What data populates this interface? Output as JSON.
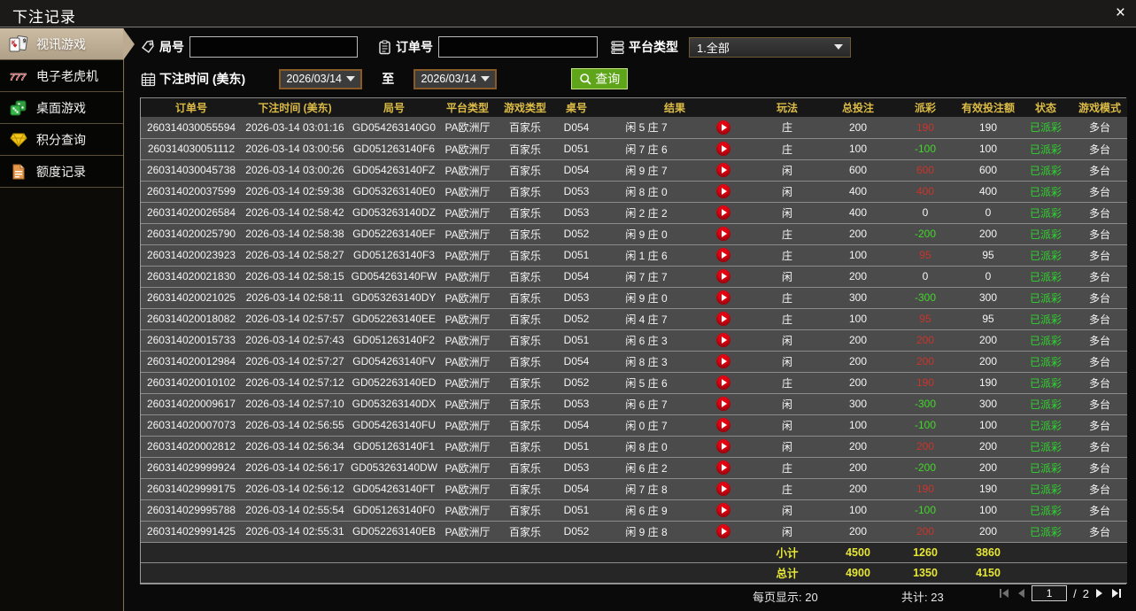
{
  "window": {
    "title": "下注记录",
    "close": "×"
  },
  "sidebar": {
    "items": [
      {
        "label": "视讯游戏",
        "icon": "playing-cards-icon",
        "active": true
      },
      {
        "label": "电子老虎机",
        "icon": "slot-777-icon",
        "active": false
      },
      {
        "label": "桌面游戏",
        "icon": "table-games-icon",
        "active": false
      },
      {
        "label": "积分查询",
        "icon": "gem-icon",
        "active": false
      },
      {
        "label": "额度记录",
        "icon": "document-icon",
        "active": false
      }
    ]
  },
  "filters": {
    "round_label": "局号",
    "round_value": "",
    "order_label": "订单号",
    "order_value": "",
    "platform_label": "平台类型",
    "platform_value": "1.全部",
    "bet_time_label": "下注时间 (美东)",
    "date_from": "2026/03/14",
    "to_label": "至",
    "date_to": "2026/03/14",
    "query_label": "查询"
  },
  "table": {
    "columns": [
      "订单号",
      "下注时间 (美东)",
      "局号",
      "平台类型",
      "游戏类型",
      "桌号",
      "结果",
      "玩法",
      "总投注",
      "派彩",
      "有效投注额",
      "状态",
      "游戏模式"
    ],
    "rows": [
      {
        "order": "260314030055594",
        "time": "2026-03-14 03:01:16",
        "round": "GD054263140G0",
        "platform": "PA欧洲厅",
        "game": "百家乐",
        "table": "D054",
        "result": "闲 5 庄 7",
        "play": "庄",
        "bet": "200",
        "payout": "190",
        "valid": "190",
        "status": "已派彩",
        "mode": "多台"
      },
      {
        "order": "260314030051112",
        "time": "2026-03-14 03:00:56",
        "round": "GD051263140F6",
        "platform": "PA欧洲厅",
        "game": "百家乐",
        "table": "D051",
        "result": "闲 7 庄 6",
        "play": "庄",
        "bet": "100",
        "payout": "-100",
        "valid": "100",
        "status": "已派彩",
        "mode": "多台"
      },
      {
        "order": "260314030045738",
        "time": "2026-03-14 03:00:26",
        "round": "GD054263140FZ",
        "platform": "PA欧洲厅",
        "game": "百家乐",
        "table": "D054",
        "result": "闲 9 庄 7",
        "play": "闲",
        "bet": "600",
        "payout": "600",
        "valid": "600",
        "status": "已派彩",
        "mode": "多台"
      },
      {
        "order": "260314020037599",
        "time": "2026-03-14 02:59:38",
        "round": "GD053263140E0",
        "platform": "PA欧洲厅",
        "game": "百家乐",
        "table": "D053",
        "result": "闲 8 庄 0",
        "play": "闲",
        "bet": "400",
        "payout": "400",
        "valid": "400",
        "status": "已派彩",
        "mode": "多台"
      },
      {
        "order": "260314020026584",
        "time": "2026-03-14 02:58:42",
        "round": "GD053263140DZ",
        "platform": "PA欧洲厅",
        "game": "百家乐",
        "table": "D053",
        "result": "闲 2 庄 2",
        "play": "闲",
        "bet": "400",
        "payout": "0",
        "valid": "0",
        "status": "已派彩",
        "mode": "多台"
      },
      {
        "order": "260314020025790",
        "time": "2026-03-14 02:58:38",
        "round": "GD052263140EF",
        "platform": "PA欧洲厅",
        "game": "百家乐",
        "table": "D052",
        "result": "闲 9 庄 0",
        "play": "庄",
        "bet": "200",
        "payout": "-200",
        "valid": "200",
        "status": "已派彩",
        "mode": "多台"
      },
      {
        "order": "260314020023923",
        "time": "2026-03-14 02:58:27",
        "round": "GD051263140F3",
        "platform": "PA欧洲厅",
        "game": "百家乐",
        "table": "D051",
        "result": "闲 1 庄 6",
        "play": "庄",
        "bet": "100",
        "payout": "95",
        "valid": "95",
        "status": "已派彩",
        "mode": "多台"
      },
      {
        "order": "260314020021830",
        "time": "2026-03-14 02:58:15",
        "round": "GD054263140FW",
        "platform": "PA欧洲厅",
        "game": "百家乐",
        "table": "D054",
        "result": "闲 7 庄 7",
        "play": "闲",
        "bet": "200",
        "payout": "0",
        "valid": "0",
        "status": "已派彩",
        "mode": "多台"
      },
      {
        "order": "260314020021025",
        "time": "2026-03-14 02:58:11",
        "round": "GD053263140DY",
        "platform": "PA欧洲厅",
        "game": "百家乐",
        "table": "D053",
        "result": "闲 9 庄 0",
        "play": "庄",
        "bet": "300",
        "payout": "-300",
        "valid": "300",
        "status": "已派彩",
        "mode": "多台"
      },
      {
        "order": "260314020018082",
        "time": "2026-03-14 02:57:57",
        "round": "GD052263140EE",
        "platform": "PA欧洲厅",
        "game": "百家乐",
        "table": "D052",
        "result": "闲 4 庄 7",
        "play": "庄",
        "bet": "100",
        "payout": "95",
        "valid": "95",
        "status": "已派彩",
        "mode": "多台"
      },
      {
        "order": "260314020015733",
        "time": "2026-03-14 02:57:43",
        "round": "GD051263140F2",
        "platform": "PA欧洲厅",
        "game": "百家乐",
        "table": "D051",
        "result": "闲 6 庄 3",
        "play": "闲",
        "bet": "200",
        "payout": "200",
        "valid": "200",
        "status": "已派彩",
        "mode": "多台"
      },
      {
        "order": "260314020012984",
        "time": "2026-03-14 02:57:27",
        "round": "GD054263140FV",
        "platform": "PA欧洲厅",
        "game": "百家乐",
        "table": "D054",
        "result": "闲 8 庄 3",
        "play": "闲",
        "bet": "200",
        "payout": "200",
        "valid": "200",
        "status": "已派彩",
        "mode": "多台"
      },
      {
        "order": "260314020010102",
        "time": "2026-03-14 02:57:12",
        "round": "GD052263140ED",
        "platform": "PA欧洲厅",
        "game": "百家乐",
        "table": "D052",
        "result": "闲 5 庄 6",
        "play": "庄",
        "bet": "200",
        "payout": "190",
        "valid": "190",
        "status": "已派彩",
        "mode": "多台"
      },
      {
        "order": "260314020009617",
        "time": "2026-03-14 02:57:10",
        "round": "GD053263140DX",
        "platform": "PA欧洲厅",
        "game": "百家乐",
        "table": "D053",
        "result": "闲 6 庄 7",
        "play": "闲",
        "bet": "300",
        "payout": "-300",
        "valid": "300",
        "status": "已派彩",
        "mode": "多台"
      },
      {
        "order": "260314020007073",
        "time": "2026-03-14 02:56:55",
        "round": "GD054263140FU",
        "platform": "PA欧洲厅",
        "game": "百家乐",
        "table": "D054",
        "result": "闲 0 庄 7",
        "play": "闲",
        "bet": "100",
        "payout": "-100",
        "valid": "100",
        "status": "已派彩",
        "mode": "多台"
      },
      {
        "order": "260314020002812",
        "time": "2026-03-14 02:56:34",
        "round": "GD051263140F1",
        "platform": "PA欧洲厅",
        "game": "百家乐",
        "table": "D051",
        "result": "闲 8 庄 0",
        "play": "闲",
        "bet": "200",
        "payout": "200",
        "valid": "200",
        "status": "已派彩",
        "mode": "多台"
      },
      {
        "order": "260314029999924",
        "time": "2026-03-14 02:56:17",
        "round": "GD053263140DW",
        "platform": "PA欧洲厅",
        "game": "百家乐",
        "table": "D053",
        "result": "闲 6 庄 2",
        "play": "庄",
        "bet": "200",
        "payout": "-200",
        "valid": "200",
        "status": "已派彩",
        "mode": "多台"
      },
      {
        "order": "260314029999175",
        "time": "2026-03-14 02:56:12",
        "round": "GD054263140FT",
        "platform": "PA欧洲厅",
        "game": "百家乐",
        "table": "D054",
        "result": "闲 7 庄 8",
        "play": "庄",
        "bet": "200",
        "payout": "190",
        "valid": "190",
        "status": "已派彩",
        "mode": "多台"
      },
      {
        "order": "260314029995788",
        "time": "2026-03-14 02:55:54",
        "round": "GD051263140F0",
        "platform": "PA欧洲厅",
        "game": "百家乐",
        "table": "D051",
        "result": "闲 6 庄 9",
        "play": "闲",
        "bet": "100",
        "payout": "-100",
        "valid": "100",
        "status": "已派彩",
        "mode": "多台"
      },
      {
        "order": "260314029991425",
        "time": "2026-03-14 02:55:31",
        "round": "GD052263140EB",
        "platform": "PA欧洲厅",
        "game": "百家乐",
        "table": "D052",
        "result": "闲 9 庄 8",
        "play": "闲",
        "bet": "200",
        "payout": "200",
        "valid": "200",
        "status": "已派彩",
        "mode": "多台"
      }
    ]
  },
  "totals": {
    "subtotal": {
      "label": "小计",
      "bet": "4500",
      "payout": "1260",
      "valid": "3860"
    },
    "total": {
      "label": "总计",
      "bet": "4900",
      "payout": "1350",
      "valid": "4150"
    }
  },
  "pagination": {
    "per_page": "每页显示: 20",
    "total_count": "共计: 23",
    "current_page": "1",
    "separator": "/",
    "total_pages": "2"
  },
  "colors": {
    "header_gold": "#dcbc46",
    "win_red": "#c8352a",
    "loss_green": "#44d62c",
    "status_green": "#2dd52d",
    "totals_yellow": "#e6e636",
    "query_green": "#5ea51a",
    "active_tab_tan": "#bcab91"
  }
}
